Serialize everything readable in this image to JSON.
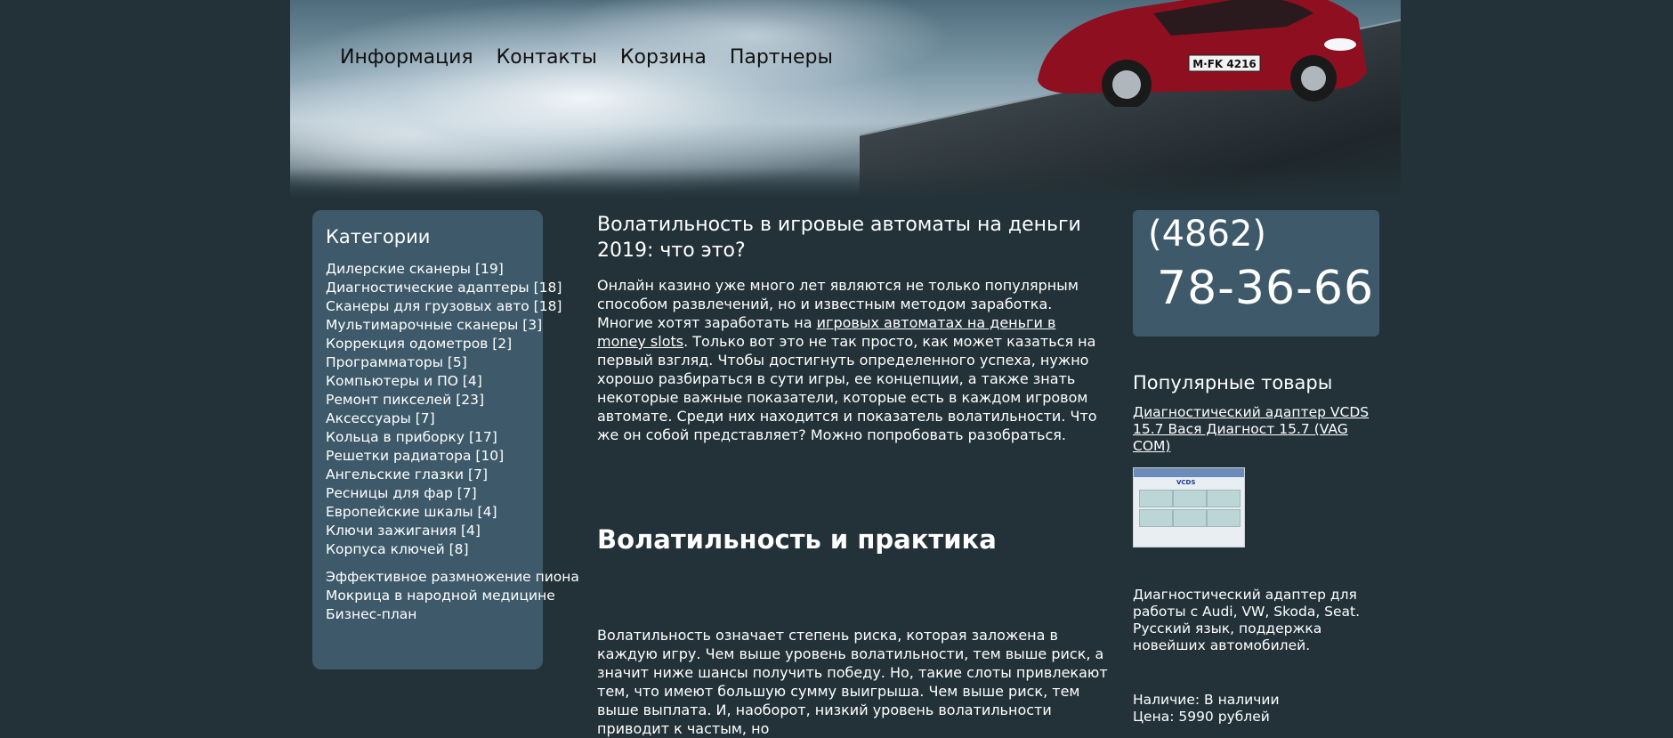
{
  "nav": {
    "items": [
      "Информация",
      "Контакты",
      "Корзина",
      "Партнеры"
    ]
  },
  "header": {
    "plate": "M·FK 4216"
  },
  "sidebar": {
    "title": "Категории",
    "categories": [
      "Дилерские сканеры [19]",
      "Диагностические адаптеры [18]",
      "Сканеры для грузовых авто [18]",
      "Мультимарочные сканеры [3]",
      "Коррекция одометров [2]",
      "Программаторы [5]",
      "Компьютеры и ПО [4]",
      "Ремонт пикселей [23]",
      "Аксессуары [7]",
      "Кольца в приборку [17]",
      "Решетки радиатора [10]",
      "Ангельские глазки [7]",
      "Ресницы для фар [7]",
      "Европейские шкалы [4]",
      "Ключи зажигания [4]",
      "Корпуса ключей [8]"
    ],
    "extra_links": [
      "Эффективное размножение пиона",
      "Мокрица в народной медицине",
      "Бизнес-план"
    ]
  },
  "article": {
    "title": "Волатильность в игровые автоматы на деньги 2019: что это?",
    "p1_before": "Онлайн казино уже много лет являются не только популярным способом развлечений, но и известным методом заработка. Многие хотят заработать на ",
    "p1_link": "игровых автоматах на деньги в money slots",
    "p1_after": ". Только вот это не так просто, как может казаться на первый взгляд. Чтобы достигнуть определенного успеха, нужно хорошо разбираться в сути игры, ее концепции, а также знать некоторые важные показатели, которые есть в каждом игровом автомате. Среди них находится и показатель волатильности. Что же он собой представляет? Можно попробовать разобраться.",
    "heading2": "Волатильность и практика",
    "p2": "Волатильность означает степень риска, которая заложена в каждую игру. Чем выше уровень волатильности, тем выше риск, а значит ниже шансы получить победу. Но, такие слоты привлекают тем, что имеют большую сумму выигрыша. Чем выше риск, тем выше выплата. И, наоборот, низкий уровень волатильности приводит к частым, но"
  },
  "phone": {
    "code": "(4862)",
    "number": "78-36-66"
  },
  "popular": {
    "title": "Популярные товары",
    "product_link": "Диагностический адаптер VCDS 15.7 Вася Диагност 15.7 (VAG COM)",
    "thumb_label": "VCDS",
    "description": "Диагностический адаптер для работы с Audi, VW, Skoda, Seat. Русский язык, поддержка новейших автомобилей.",
    "availability": "Наличие: В наличии",
    "price": "Цена: 5990 рублей"
  }
}
